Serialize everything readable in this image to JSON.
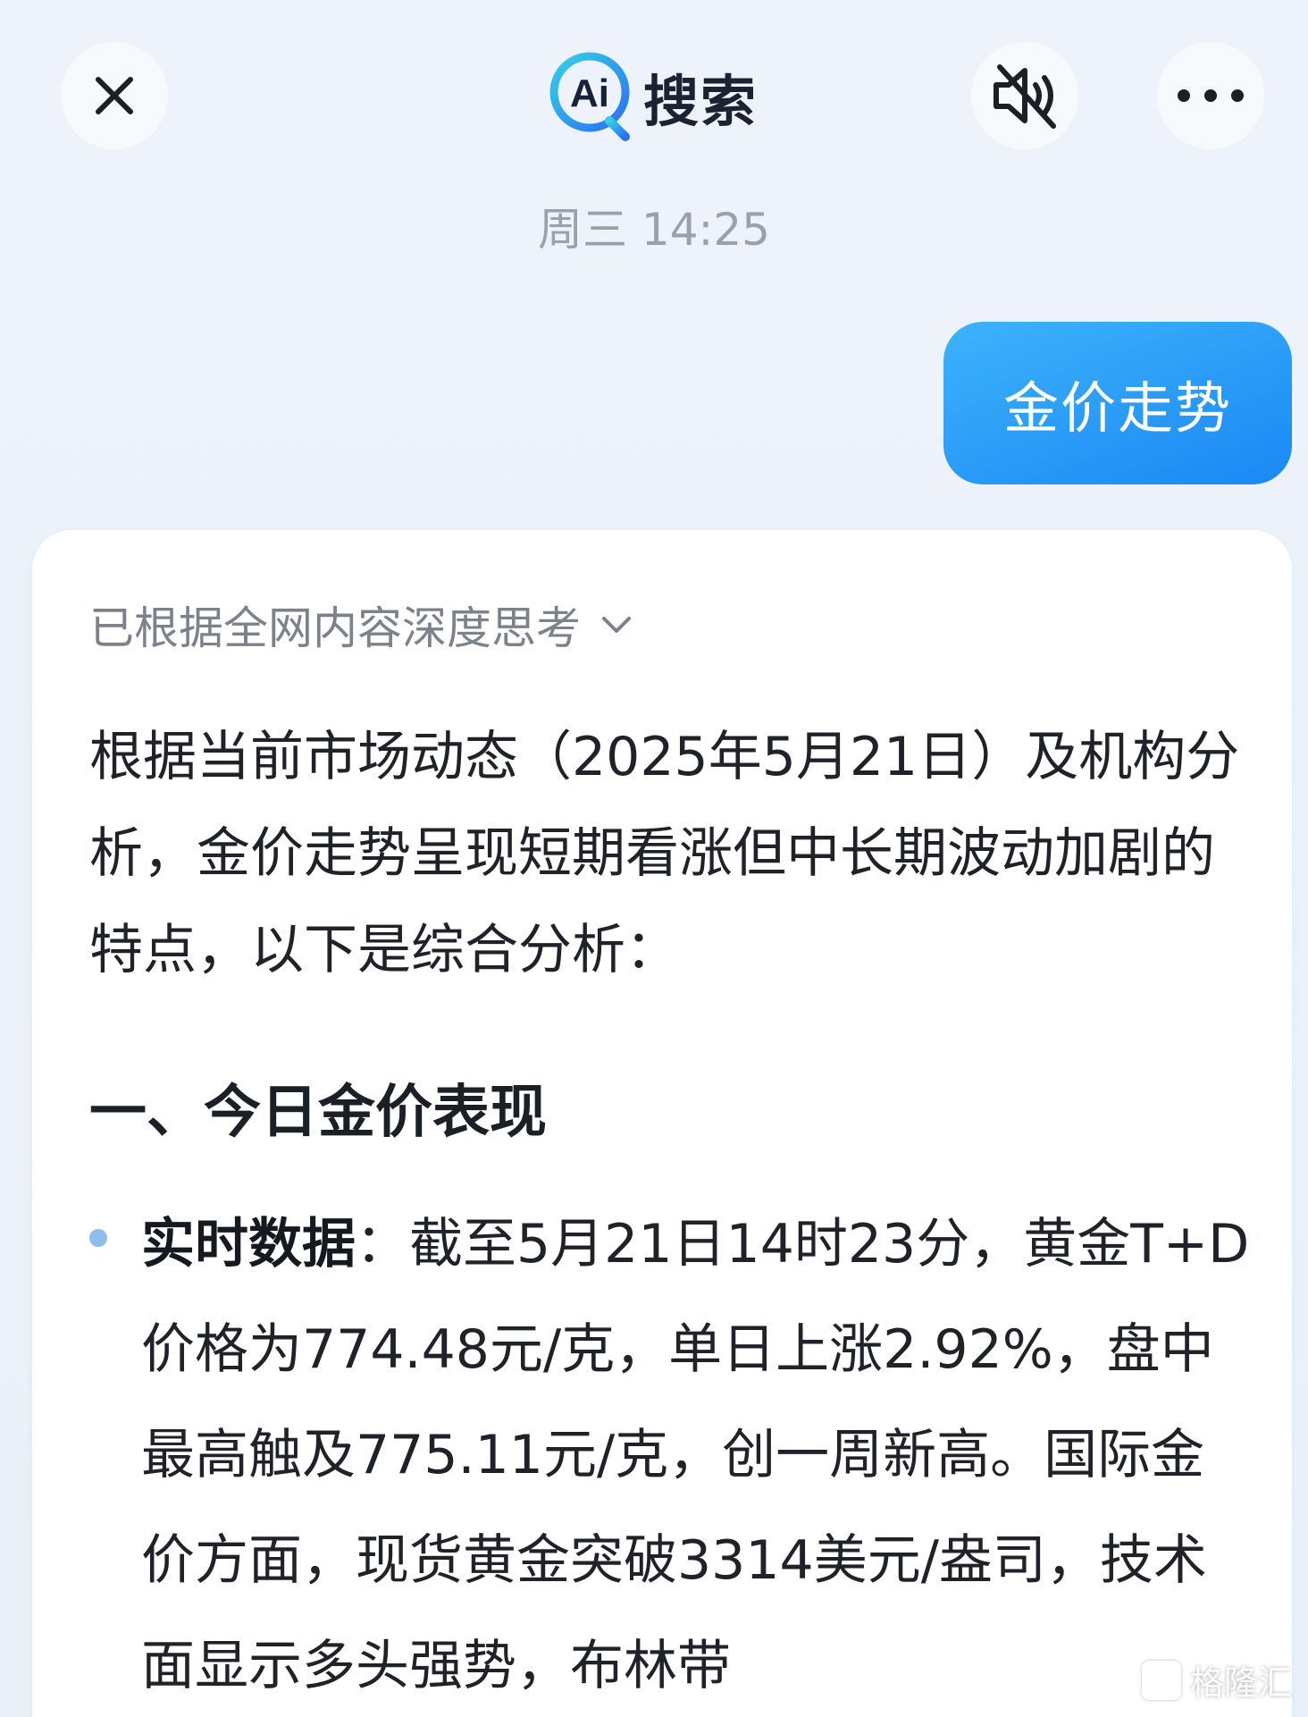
{
  "header": {
    "logo_mark_text": "Ai",
    "logo_text": "搜索",
    "close_icon": "close-icon",
    "mute_icon": "speaker-muted-icon",
    "more_icon": "more-dots-icon"
  },
  "timestamp": "周三 14:25",
  "user_message": "金价走势",
  "answer": {
    "thinking_label": "已根据全网内容深度思考",
    "intro": "根据当前市场动态（2025年5月21日）及机构分析，金价走势呈现短期看涨但中长期波动加剧的特点，以下是综合分析：",
    "section_title": "一、今日金价表现",
    "bullet_label": "实时数据",
    "bullet_sep": "：",
    "bullet_text": "截至5月21日14时23分，黄金T+D价格为774.48元/克，单日上涨2.92%，盘中最高触及775.11元/克，创一周新高。国际金价方面，现货黄金突破3314美元/盎司，技术面显示多头强势，布林带"
  },
  "watermark": "格隆汇",
  "colors": {
    "bubble_start": "#3db3fb",
    "bubble_end": "#1a88f4",
    "bullet_dot": "#8fbcf0",
    "text": "#1f2329",
    "muted": "#7c828c"
  }
}
